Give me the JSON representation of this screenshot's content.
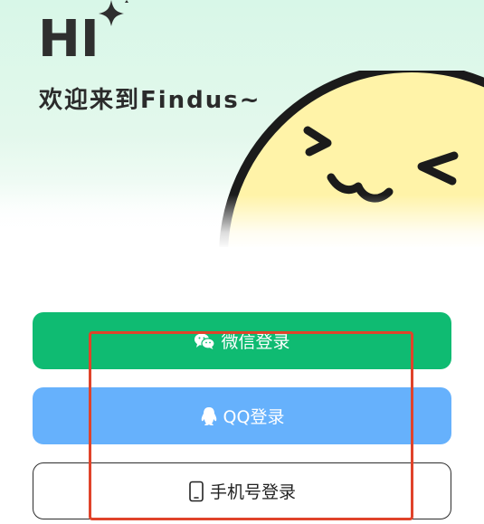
{
  "hero": {
    "logo_text": "HI",
    "welcome_text": "欢迎来到Findus~"
  },
  "login": {
    "wechat_label": "微信登录",
    "qq_label": "QQ登录",
    "phone_label": "手机号登录"
  },
  "colors": {
    "wechat": "#0fbb72",
    "qq": "#66b1fc",
    "highlight": "#e0432a",
    "mascot_face": "#fff3a8"
  },
  "icons": {
    "wechat": "wechat-icon",
    "qq": "qq-penguin-icon",
    "phone": "mobile-phone-icon",
    "sparkle": "sparkle-icon"
  }
}
